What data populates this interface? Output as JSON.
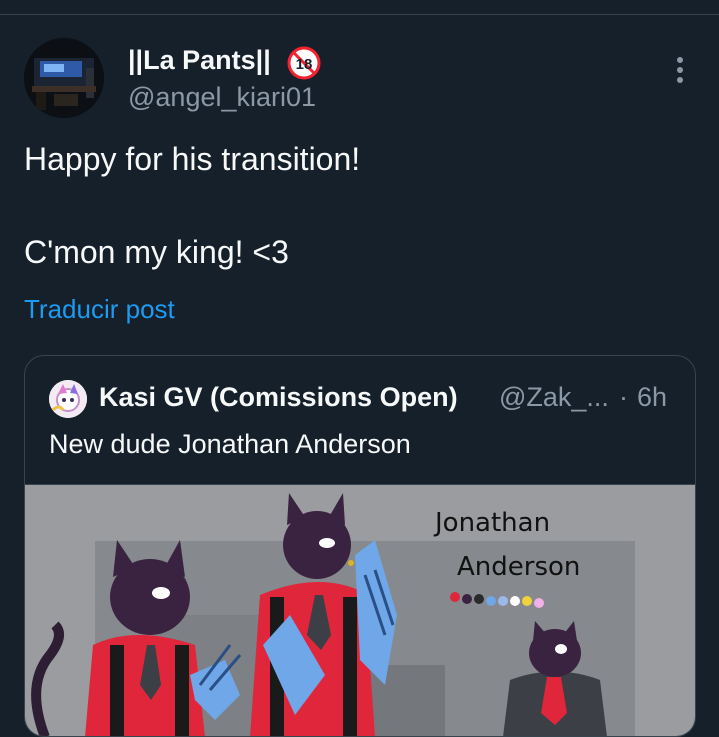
{
  "post": {
    "author": {
      "display_name": "||La Pants||",
      "handle": "@angel_kiari01",
      "badge_text": "18"
    },
    "text_lines": [
      "Happy for his transition!",
      "C'mon my king! <3"
    ],
    "translate_label": "Traducir post"
  },
  "quoted": {
    "author": {
      "display_name": "Kasi GV (Comissions Open)",
      "handle": "@Zak_...",
      "separator": "·",
      "time": "6h"
    },
    "text": "New dude Jonathan Anderson",
    "image_caption_line1": "Jonathan",
    "image_caption_line2": "Anderson"
  },
  "colors": {
    "background": "#15202b",
    "accent": "#1d9bf0",
    "muted": "#8b98a5",
    "badge": "#f4212e"
  },
  "icons": {
    "more": "more-vertical-icon",
    "age_badge": "no-under-18-icon"
  }
}
